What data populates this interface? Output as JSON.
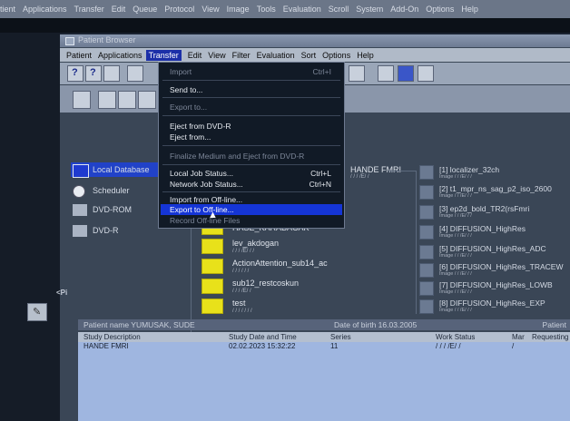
{
  "outer_menu": [
    "tient",
    "Applications",
    "Transfer",
    "Edit",
    "Queue",
    "Protocol",
    "View",
    "Image",
    "Tools",
    "Evaluation",
    "Scroll",
    "System",
    "Add-On",
    "Options",
    "Help"
  ],
  "window": {
    "title": "Patient Browser",
    "menu": [
      "Patient",
      "Applications",
      "Transfer",
      "Edit",
      "View",
      "Filter",
      "Evaluation",
      "Sort",
      "Options",
      "Help"
    ]
  },
  "transfer_menu": {
    "items": [
      {
        "label": "Import",
        "shortcut": "Ctrl+I",
        "disabled": true
      },
      {
        "label": "Send to...",
        "disabled": false
      },
      {
        "label": "Export to...",
        "disabled": true
      },
      {
        "label": "Eject from DVD-R",
        "disabled": false
      },
      {
        "label": "Eject from...",
        "disabled": false
      },
      {
        "label": "Finalize Medium and Eject from DVD-R",
        "disabled": true
      },
      {
        "label": "Local Job Status...",
        "shortcut": "Ctrl+L",
        "disabled": false
      },
      {
        "label": "Network Job Status...",
        "shortcut": "Ctrl+N",
        "disabled": false
      },
      {
        "label": "Import from Off-line...",
        "disabled": false
      },
      {
        "label": "Export to Off-line...",
        "disabled": false,
        "highlighted": true
      },
      {
        "label": "Record Off-line Files",
        "disabled": true
      }
    ]
  },
  "tree": [
    "Local Database",
    "Scheduler",
    "DVD-ROM",
    "DVD-R"
  ],
  "patients": [
    {
      "name": "HASE_KARABACAK",
      "sub": ""
    },
    {
      "name": "lev_akdogan",
      "sub": "/ / / /E/ /  /"
    },
    {
      "name": "ActionAttention_sub14_ac",
      "sub": "/ / / / / /"
    },
    {
      "name": "sub12_restcoskun",
      "sub": "/ / / /E/ /"
    },
    {
      "name": "test",
      "sub": "/ / / / / / /"
    }
  ],
  "study_label": "HANDE FMRI",
  "study_sub": "/ / / /E/ /",
  "series": [
    {
      "name": "[1] localizer_32ch",
      "sub": "Image / / /E/ /  /"
    },
    {
      "name": "[2] t1_mpr_ns_sag_p2_iso_2600",
      "sub": "Image / / /E/ /  /"
    },
    {
      "name": "[3] ep2d_bold_TR2(rsFmri",
      "sub": "Image / / /E/ /  /"
    },
    {
      "name": "[4] DIFFUSION_HighRes",
      "sub": "Image / / /E/ /  /"
    },
    {
      "name": "[5] DIFFUSION_HighRes_ADC",
      "sub": "Image / / /E/ /  /"
    },
    {
      "name": "[6] DIFFUSION_HighRes_TRACEW",
      "sub": "Image / / /E/ /  /"
    },
    {
      "name": "[7] DIFFUSION_HighRes_LOWB",
      "sub": "Image / / /E/ /  /"
    },
    {
      "name": "[8] DIFFUSION_HighRes_EXP",
      "sub": "Image / / /E/ /  /"
    }
  ],
  "side_tab": "<Pi",
  "info_bar": {
    "patient_name": "Patient name YUMUSAK, SUDE",
    "dob": "Date of birth 16.03.2005",
    "right": "Patient"
  },
  "study_table": {
    "headers": [
      "Study Description",
      "Study Date and Time",
      "Series",
      "Work Status",
      "Mar",
      "Requesting"
    ],
    "row": [
      "HANDE FMRI",
      "02.02.2023 15:32:22",
      "11",
      "/ / / /E/ /",
      "/",
      ""
    ]
  }
}
